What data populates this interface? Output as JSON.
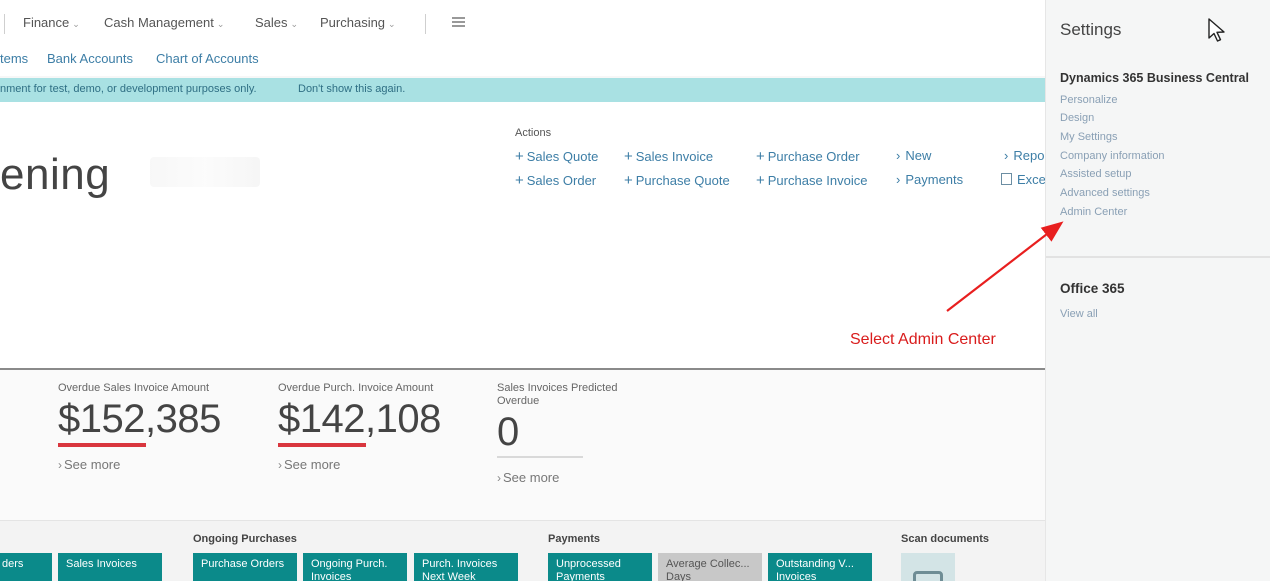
{
  "topnav": {
    "menus": [
      {
        "label": "Finance"
      },
      {
        "label": "Cash Management"
      },
      {
        "label": "Sales"
      },
      {
        "label": "Purchasing"
      }
    ]
  },
  "subnav": {
    "links": [
      {
        "label": "tems"
      },
      {
        "label": "Bank Accounts"
      },
      {
        "label": "Chart of Accounts"
      }
    ]
  },
  "banner": {
    "message": "nment for test, demo, or development purposes only.",
    "dismiss": "Don't show this again."
  },
  "headline": {
    "greeting": "ening"
  },
  "actions": {
    "title": "Actions",
    "items": [
      {
        "label": "Sales Quote"
      },
      {
        "label": "Sales Order"
      },
      {
        "label": "Sales Invoice"
      },
      {
        "label": "Purchase Quote"
      },
      {
        "label": "Purchase Order"
      },
      {
        "label": "Purchase Invoice"
      },
      {
        "label": "New"
      },
      {
        "label": "Payments"
      },
      {
        "label": "Repo"
      },
      {
        "label": "Exce"
      }
    ]
  },
  "kpis": [
    {
      "label": "Overdue Sales Invoice Amount",
      "value": "$152,385",
      "see_more": "See more",
      "bar_color": "#d9363e"
    },
    {
      "label": "Overdue Purch. Invoice Amount",
      "value": "$142,108",
      "see_more": "See more",
      "bar_color": "#d9363e"
    },
    {
      "label": "Sales Invoices Predicted Overdue",
      "value": "0",
      "see_more": "See more",
      "bar_color": "#d9d9d9"
    }
  ],
  "tiles": {
    "groups": [
      {
        "title": "Ongoing Purchases"
      },
      {
        "title": "Payments"
      },
      {
        "title": "Scan documents"
      }
    ],
    "items": [
      {
        "label": "ders"
      },
      {
        "label": "Sales Invoices"
      },
      {
        "label": "Purchase Orders"
      },
      {
        "label": "Ongoing Purch. Invoices"
      },
      {
        "label": "Purch. Invoices Next Week"
      },
      {
        "label": "Unprocessed Payments"
      },
      {
        "label": "Average Collec... Days"
      },
      {
        "label": "Outstanding V... Invoices"
      }
    ]
  },
  "settings": {
    "title": "Settings",
    "d365": {
      "title": "Dynamics 365 Business Central",
      "links": [
        {
          "label": "Personalize"
        },
        {
          "label": "Design"
        },
        {
          "label": "My Settings"
        },
        {
          "label": "Company information"
        },
        {
          "label": "Assisted setup"
        },
        {
          "label": "Advanced settings"
        },
        {
          "label": "Admin Center"
        }
      ]
    },
    "office": {
      "title": "Office 365",
      "view_all": "View all"
    }
  },
  "annotation": {
    "text": "Select Admin Center",
    "color": "#d91c1c"
  },
  "colors": {
    "accent": "#3d7ea6",
    "banner": "#a9e1e3",
    "tile": "#0b8a8a"
  }
}
